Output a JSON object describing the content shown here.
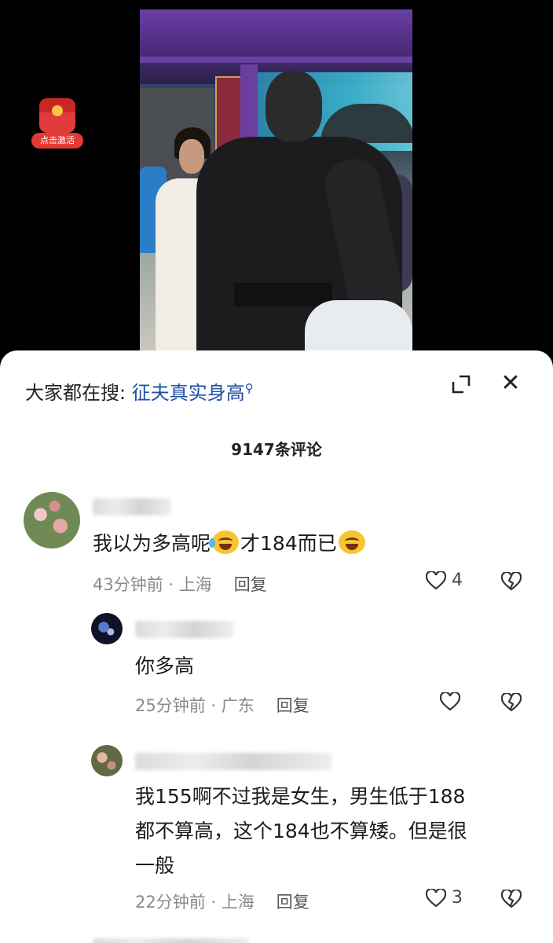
{
  "badge": {
    "label": "点击激活"
  },
  "search": {
    "prefix": "大家都在搜:",
    "keyword": "征夫真实身高",
    "icon": "search-icon"
  },
  "comments_header": {
    "count_label": "9147条评论"
  },
  "comments": [
    {
      "text_a": "我以为多高呢",
      "text_b": "才184而已",
      "time": "43分钟前",
      "location": "上海",
      "reply_label": "回复",
      "likes": "4"
    },
    {
      "text": "你多高",
      "time": "25分钟前",
      "location": "广东",
      "reply_label": "回复",
      "likes": ""
    },
    {
      "text_line1": "我155啊不过我是女生，男生低于188",
      "text_line2": "都不算高，这个184也不算矮。但是很",
      "text_line3": "一般",
      "time": "22分钟前",
      "location": "上海",
      "reply_label": "回复",
      "likes": "3"
    }
  ],
  "colors": {
    "accent": "#1f4fa8",
    "badge_red": "#e53935"
  }
}
